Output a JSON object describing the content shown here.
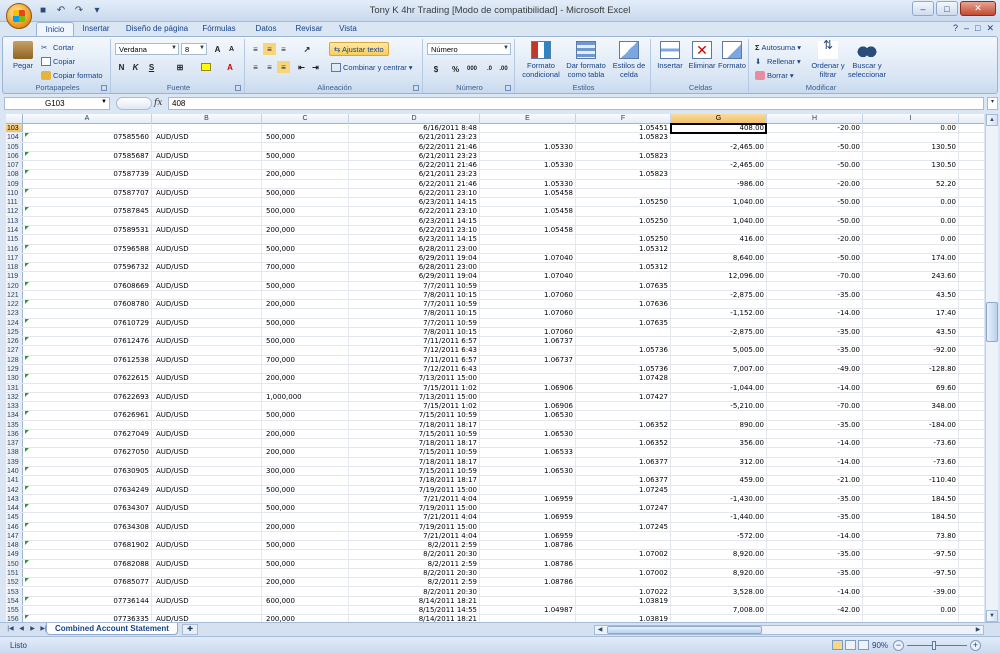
{
  "window": {
    "title": "Tony K 4hr Trading  [Modo de compatibilidad] - Microsoft Excel",
    "minimize": "–",
    "maximize": "□",
    "close": "✕"
  },
  "tabs": [
    "Inicio",
    "Insertar",
    "Diseño de página",
    "Fórmulas",
    "Datos",
    "Revisar",
    "Vista"
  ],
  "active_tab": "Inicio",
  "ribbon": {
    "clipboard": {
      "label": "Portapapeles",
      "paste": "Pegar",
      "cut": "Cortar",
      "copy": "Copiar",
      "format_painter": "Copiar formato"
    },
    "font": {
      "label": "Fuente",
      "family": "Verdana",
      "size": "8",
      "bold": "N",
      "italic": "K",
      "underline": "S"
    },
    "alignment": {
      "label": "Alineación",
      "wrap_text": "Ajustar texto",
      "merge_center": "Combinar y centrar"
    },
    "number": {
      "label": "Número",
      "format": "Número",
      "currency": "$",
      "percent": "%",
      "thousands": "000"
    },
    "styles": {
      "label": "Estilos",
      "conditional": "Formato condicional",
      "as_table": "Dar formato como tabla",
      "cell_styles": "Estilos de celda"
    },
    "cells": {
      "label": "Celdas",
      "insert": "Insertar",
      "delete": "Eliminar",
      "format": "Formato"
    },
    "editing": {
      "label": "Modificar",
      "autosum": "Autosuma",
      "fill": "Rellenar",
      "clear": "Borrar",
      "sort_filter": "Ordenar y filtrar",
      "find_select": "Buscar y seleccionar"
    }
  },
  "formula_bar": {
    "name_box": "G103",
    "fx": "fx",
    "value": "408"
  },
  "columns": [
    "A",
    "B",
    "C",
    "D",
    "E",
    "F",
    "G",
    "H",
    "I"
  ],
  "selected_column": "G",
  "rows": [
    {
      "n": "103",
      "A": "",
      "B": "",
      "C": "",
      "D": "6/16/2011 8:48",
      "E": "",
      "F": "1.05451",
      "G": "408.00",
      "H": "-20.00",
      "I": "0.00"
    },
    {
      "n": "104",
      "A": "07585560",
      "B": "AUD/USD",
      "C": "500,000",
      "D": "6/21/2011 23:23",
      "E": "",
      "F": "1.05823",
      "G": "",
      "H": "",
      "I": ""
    },
    {
      "n": "105",
      "A": "",
      "B": "",
      "C": "",
      "D": "6/22/2011 21:46",
      "E": "1.05330",
      "F": "",
      "G": "-2,465.00",
      "H": "-50.00",
      "I": "130.50"
    },
    {
      "n": "106",
      "A": "07585687",
      "B": "AUD/USD",
      "C": "500,000",
      "D": "6/21/2011 23:23",
      "E": "",
      "F": "1.05823",
      "G": "",
      "H": "",
      "I": ""
    },
    {
      "n": "107",
      "A": "",
      "B": "",
      "C": "",
      "D": "6/22/2011 21:46",
      "E": "1.05330",
      "F": "",
      "G": "-2,465.00",
      "H": "-50.00",
      "I": "130.50"
    },
    {
      "n": "108",
      "A": "07587739",
      "B": "AUD/USD",
      "C": "200,000",
      "D": "6/21/2011 23:23",
      "E": "",
      "F": "1.05823",
      "G": "",
      "H": "",
      "I": ""
    },
    {
      "n": "109",
      "A": "",
      "B": "",
      "C": "",
      "D": "6/22/2011 21:46",
      "E": "1.05330",
      "F": "",
      "G": "-986.00",
      "H": "-20.00",
      "I": "52.20"
    },
    {
      "n": "110",
      "A": "07587707",
      "B": "AUD/USD",
      "C": "500,000",
      "D": "6/22/2011 23:10",
      "E": "1.05458",
      "F": "",
      "G": "",
      "H": "",
      "I": ""
    },
    {
      "n": "111",
      "A": "",
      "B": "",
      "C": "",
      "D": "6/23/2011 14:15",
      "E": "",
      "F": "1.05250",
      "G": "1,040.00",
      "H": "-50.00",
      "I": "0.00"
    },
    {
      "n": "112",
      "A": "07587845",
      "B": "AUD/USD",
      "C": "500,000",
      "D": "6/22/2011 23:10",
      "E": "1.05458",
      "F": "",
      "G": "",
      "H": "",
      "I": ""
    },
    {
      "n": "113",
      "A": "",
      "B": "",
      "C": "",
      "D": "6/23/2011 14:15",
      "E": "",
      "F": "1.05250",
      "G": "1,040.00",
      "H": "-50.00",
      "I": "0.00"
    },
    {
      "n": "114",
      "A": "07589531",
      "B": "AUD/USD",
      "C": "200,000",
      "D": "6/22/2011 23:10",
      "E": "1.05458",
      "F": "",
      "G": "",
      "H": "",
      "I": ""
    },
    {
      "n": "115",
      "A": "",
      "B": "",
      "C": "",
      "D": "6/23/2011 14:15",
      "E": "",
      "F": "1.05250",
      "G": "416.00",
      "H": "-20.00",
      "I": "0.00"
    },
    {
      "n": "116",
      "A": "07596588",
      "B": "AUD/USD",
      "C": "500,000",
      "D": "6/28/2011 23:00",
      "E": "",
      "F": "1.05312",
      "G": "",
      "H": "",
      "I": ""
    },
    {
      "n": "117",
      "A": "",
      "B": "",
      "C": "",
      "D": "6/29/2011 19:04",
      "E": "1.07040",
      "F": "",
      "G": "8,640.00",
      "H": "-50.00",
      "I": "174.00"
    },
    {
      "n": "118",
      "A": "07596732",
      "B": "AUD/USD",
      "C": "700,000",
      "D": "6/28/2011 23:00",
      "E": "",
      "F": "1.05312",
      "G": "",
      "H": "",
      "I": ""
    },
    {
      "n": "119",
      "A": "",
      "B": "",
      "C": "",
      "D": "6/29/2011 19:04",
      "E": "1.07040",
      "F": "",
      "G": "12,096.00",
      "H": "-70.00",
      "I": "243.60"
    },
    {
      "n": "120",
      "A": "07608669",
      "B": "AUD/USD",
      "C": "500,000",
      "D": "7/7/2011 10:59",
      "E": "",
      "F": "1.07635",
      "G": "",
      "H": "",
      "I": ""
    },
    {
      "n": "121",
      "A": "",
      "B": "",
      "C": "",
      "D": "7/8/2011 10:15",
      "E": "1.07060",
      "F": "",
      "G": "-2,875.00",
      "H": "-35.00",
      "I": "43.50"
    },
    {
      "n": "122",
      "A": "07608780",
      "B": "AUD/USD",
      "C": "200,000",
      "D": "7/7/2011 10:59",
      "E": "",
      "F": "1.07636",
      "G": "",
      "H": "",
      "I": ""
    },
    {
      "n": "123",
      "A": "",
      "B": "",
      "C": "",
      "D": "7/8/2011 10:15",
      "E": "1.07060",
      "F": "",
      "G": "-1,152.00",
      "H": "-14.00",
      "I": "17.40"
    },
    {
      "n": "124",
      "A": "07610729",
      "B": "AUD/USD",
      "C": "500,000",
      "D": "7/7/2011 10:59",
      "E": "",
      "F": "1.07635",
      "G": "",
      "H": "",
      "I": ""
    },
    {
      "n": "125",
      "A": "",
      "B": "",
      "C": "",
      "D": "7/8/2011 10:15",
      "E": "1.07060",
      "F": "",
      "G": "-2,875.00",
      "H": "-35.00",
      "I": "43.50"
    },
    {
      "n": "126",
      "A": "07612476",
      "B": "AUD/USD",
      "C": "500,000",
      "D": "7/11/2011 6:57",
      "E": "1.06737",
      "F": "",
      "G": "",
      "H": "",
      "I": ""
    },
    {
      "n": "127",
      "A": "",
      "B": "",
      "C": "",
      "D": "7/12/2011 6:43",
      "E": "",
      "F": "1.05736",
      "G": "5,005.00",
      "H": "-35.00",
      "I": "-92.00"
    },
    {
      "n": "128",
      "A": "07612538",
      "B": "AUD/USD",
      "C": "700,000",
      "D": "7/11/2011 6:57",
      "E": "1.06737",
      "F": "",
      "G": "",
      "H": "",
      "I": ""
    },
    {
      "n": "129",
      "A": "",
      "B": "",
      "C": "",
      "D": "7/12/2011 6:43",
      "E": "",
      "F": "1.05736",
      "G": "7,007.00",
      "H": "-49.00",
      "I": "-128.80"
    },
    {
      "n": "130",
      "A": "07622615",
      "B": "AUD/USD",
      "C": "200,000",
      "D": "7/13/2011 15:00",
      "E": "",
      "F": "1.07428",
      "G": "",
      "H": "",
      "I": ""
    },
    {
      "n": "131",
      "A": "",
      "B": "",
      "C": "",
      "D": "7/15/2011 1:02",
      "E": "1.06906",
      "F": "",
      "G": "-1,044.00",
      "H": "-14.00",
      "I": "69.60"
    },
    {
      "n": "132",
      "A": "07622693",
      "B": "AUD/USD",
      "C": "1,000,000",
      "D": "7/13/2011 15:00",
      "E": "",
      "F": "1.07427",
      "G": "",
      "H": "",
      "I": ""
    },
    {
      "n": "133",
      "A": "",
      "B": "",
      "C": "",
      "D": "7/15/2011 1:02",
      "E": "1.06906",
      "F": "",
      "G": "-5,210.00",
      "H": "-70.00",
      "I": "348.00"
    },
    {
      "n": "134",
      "A": "07626961",
      "B": "AUD/USD",
      "C": "500,000",
      "D": "7/15/2011 10:59",
      "E": "1.06530",
      "F": "",
      "G": "",
      "H": "",
      "I": ""
    },
    {
      "n": "135",
      "A": "",
      "B": "",
      "C": "",
      "D": "7/18/2011 18:17",
      "E": "",
      "F": "1.06352",
      "G": "890.00",
      "H": "-35.00",
      "I": "-184.00"
    },
    {
      "n": "136",
      "A": "07627049",
      "B": "AUD/USD",
      "C": "200,000",
      "D": "7/15/2011 10:59",
      "E": "1.06530",
      "F": "",
      "G": "",
      "H": "",
      "I": ""
    },
    {
      "n": "137",
      "A": "",
      "B": "",
      "C": "",
      "D": "7/18/2011 18:17",
      "E": "",
      "F": "1.06352",
      "G": "356.00",
      "H": "-14.00",
      "I": "-73.60"
    },
    {
      "n": "138",
      "A": "07627050",
      "B": "AUD/USD",
      "C": "200,000",
      "D": "7/15/2011 10:59",
      "E": "1.06533",
      "F": "",
      "G": "",
      "H": "",
      "I": ""
    },
    {
      "n": "139",
      "A": "",
      "B": "",
      "C": "",
      "D": "7/18/2011 18:17",
      "E": "",
      "F": "1.06377",
      "G": "312.00",
      "H": "-14.00",
      "I": "-73.60"
    },
    {
      "n": "140",
      "A": "07630905",
      "B": "AUD/USD",
      "C": "300,000",
      "D": "7/15/2011 10:59",
      "E": "1.06530",
      "F": "",
      "G": "",
      "H": "",
      "I": ""
    },
    {
      "n": "141",
      "A": "",
      "B": "",
      "C": "",
      "D": "7/18/2011 18:17",
      "E": "",
      "F": "1.06377",
      "G": "459.00",
      "H": "-21.00",
      "I": "-110.40"
    },
    {
      "n": "142",
      "A": "07634249",
      "B": "AUD/USD",
      "C": "500,000",
      "D": "7/19/2011 15:00",
      "E": "",
      "F": "1.07245",
      "G": "",
      "H": "",
      "I": ""
    },
    {
      "n": "143",
      "A": "",
      "B": "",
      "C": "",
      "D": "7/21/2011 4:04",
      "E": "1.06959",
      "F": "",
      "G": "-1,430.00",
      "H": "-35.00",
      "I": "184.50"
    },
    {
      "n": "144",
      "A": "07634307",
      "B": "AUD/USD",
      "C": "500,000",
      "D": "7/19/2011 15:00",
      "E": "",
      "F": "1.07247",
      "G": "",
      "H": "",
      "I": ""
    },
    {
      "n": "145",
      "A": "",
      "B": "",
      "C": "",
      "D": "7/21/2011 4:04",
      "E": "1.06959",
      "F": "",
      "G": "-1,440.00",
      "H": "-35.00",
      "I": "184.50"
    },
    {
      "n": "146",
      "A": "07634308",
      "B": "AUD/USD",
      "C": "200,000",
      "D": "7/19/2011 15:00",
      "E": "",
      "F": "1.07245",
      "G": "",
      "H": "",
      "I": ""
    },
    {
      "n": "147",
      "A": "",
      "B": "",
      "C": "",
      "D": "7/21/2011 4:04",
      "E": "1.06959",
      "F": "",
      "G": "-572.00",
      "H": "-14.00",
      "I": "73.80"
    },
    {
      "n": "148",
      "A": "07681902",
      "B": "AUD/USD",
      "C": "500,000",
      "D": "8/2/2011 2:59",
      "E": "1.08786",
      "F": "",
      "G": "",
      "H": "",
      "I": ""
    },
    {
      "n": "149",
      "A": "",
      "B": "",
      "C": "",
      "D": "8/2/2011 20:30",
      "E": "",
      "F": "1.07002",
      "G": "8,920.00",
      "H": "-35.00",
      "I": "-97.50"
    },
    {
      "n": "150",
      "A": "07682088",
      "B": "AUD/USD",
      "C": "500,000",
      "D": "8/2/2011 2:59",
      "E": "1.08786",
      "F": "",
      "G": "",
      "H": "",
      "I": ""
    },
    {
      "n": "151",
      "A": "",
      "B": "",
      "C": "",
      "D": "8/2/2011 20:30",
      "E": "",
      "F": "1.07002",
      "G": "8,920.00",
      "H": "-35.00",
      "I": "-97.50"
    },
    {
      "n": "152",
      "A": "07685077",
      "B": "AUD/USD",
      "C": "200,000",
      "D": "8/2/2011 2:59",
      "E": "1.08786",
      "F": "",
      "G": "",
      "H": "",
      "I": ""
    },
    {
      "n": "153",
      "A": "",
      "B": "",
      "C": "",
      "D": "8/2/2011 20:30",
      "E": "",
      "F": "1.07022",
      "G": "3,528.00",
      "H": "-14.00",
      "I": "-39.00"
    },
    {
      "n": "154",
      "A": "07736144",
      "B": "AUD/USD",
      "C": "600,000",
      "D": "8/14/2011 18:21",
      "E": "",
      "F": "1.03819",
      "G": "",
      "H": "",
      "I": ""
    },
    {
      "n": "155",
      "A": "",
      "B": "",
      "C": "",
      "D": "8/15/2011 14:55",
      "E": "1.04987",
      "F": "",
      "G": "7,008.00",
      "H": "-42.00",
      "I": "0.00"
    },
    {
      "n": "156",
      "A": "07736335",
      "B": "AUD/USD",
      "C": "200,000",
      "D": "8/14/2011 18:21",
      "E": "",
      "F": "1.03819",
      "G": "",
      "H": "",
      "I": ""
    }
  ],
  "sheet_tab": "Combined Account Statement",
  "status": {
    "ready": "Listo",
    "zoom": "90%"
  }
}
